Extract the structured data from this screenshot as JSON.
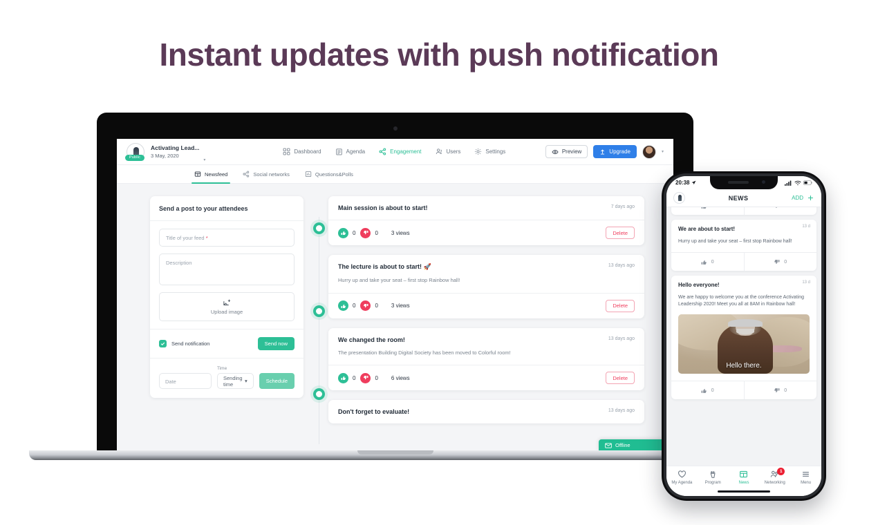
{
  "headline": "Instant updates with push notification",
  "laptop": {
    "appbar": {
      "event_name": "Activating Lead...",
      "event_date": "3 May, 2020",
      "visibility_badge": "Public",
      "caret": "▾",
      "nav": [
        {
          "label": "Dashboard",
          "icon": "grid-icon",
          "active": false
        },
        {
          "label": "Agenda",
          "icon": "calendar-icon",
          "active": false
        },
        {
          "label": "Engagement",
          "icon": "share-icon",
          "active": true
        },
        {
          "label": "Users",
          "icon": "users-icon",
          "active": false
        },
        {
          "label": "Settings",
          "icon": "gear-icon",
          "active": false
        }
      ],
      "preview_label": "Preview",
      "upgrade_label": "Upgrade"
    },
    "tabs": [
      {
        "label": "Newsfeed",
        "icon": "newsfeed-icon",
        "active": true
      },
      {
        "label": "Social networks",
        "icon": "share-icon",
        "active": false
      },
      {
        "label": "Questions&Polls",
        "icon": "poll-icon",
        "active": false
      }
    ],
    "compose": {
      "heading": "Send a post to your attendees",
      "title_placeholder": "Title of your feed",
      "title_required_mark": "*",
      "title_value": "",
      "description_placeholder": "Description",
      "description_value": "",
      "upload_label": "Upload image",
      "notification_label": "Send notification",
      "notification_checked": true,
      "send_now_label": "Send now",
      "date_placeholder": "Date",
      "date_value": "",
      "time_label": "Time",
      "time_value": "Sending time",
      "time_caret": "▾",
      "schedule_label": "Schedule"
    },
    "posts": [
      {
        "title": "Main session is about to start!",
        "time": "7 days ago",
        "text": "",
        "likes": "0",
        "dislikes": "0",
        "views": "3 views",
        "delete_label": "Delete"
      },
      {
        "title": "The lecture is about to start! 🚀",
        "time": "13 days ago",
        "text": "Hurry up and take your seat – first stop Rainbow hall!",
        "likes": "0",
        "dislikes": "0",
        "views": "3 views",
        "delete_label": "Delete"
      },
      {
        "title": "We changed the room!",
        "time": "13 days ago",
        "text": "The presentation Building Digital Society has been moved to Colorful room!",
        "likes": "0",
        "dislikes": "0",
        "views": "6 views",
        "delete_label": "Delete"
      },
      {
        "title": "Don't forget to evaluate!",
        "time": "13 days ago",
        "text": "",
        "likes": "",
        "dislikes": "",
        "views": "",
        "delete_label": ""
      }
    ],
    "chat_widget": {
      "label": "Offline",
      "icon": "envelope-icon"
    }
  },
  "phone": {
    "statusbar": {
      "time": "20:38",
      "location_icon": "location-arrow-icon",
      "signal_icon": "signal-icon",
      "wifi_icon": "wifi-icon",
      "battery_icon": "battery-icon"
    },
    "header": {
      "title": "NEWS",
      "add_label": "ADD",
      "add_icon": "plus-icon",
      "logo_icon": "event-logo-icon"
    },
    "cards": [
      {
        "title": "We are about to start!",
        "day": "13 d",
        "text": "Hurry up and take your seat – first stop Rainbow hall!",
        "likes": "0",
        "dislikes": "0",
        "has_image": false,
        "image_caption": ""
      },
      {
        "title": "Hello everyone!",
        "day": "13 d",
        "text": "We are happy to welcome you at the conference Activating Leadership 2020! Meet you all at 8AM in Rainbow hall!",
        "likes": "0",
        "dislikes": "0",
        "has_image": true,
        "image_caption": "Hello there."
      }
    ],
    "tabbar": [
      {
        "label": "My Agenda",
        "icon": "heart-icon",
        "active": false,
        "badge": ""
      },
      {
        "label": "Program",
        "icon": "podium-icon",
        "active": false,
        "badge": ""
      },
      {
        "label": "News",
        "icon": "news-icon",
        "active": true,
        "badge": ""
      },
      {
        "label": "Networking",
        "icon": "networking-icon",
        "active": false,
        "badge": "1"
      },
      {
        "label": "Menu",
        "icon": "hamburger-icon",
        "active": false,
        "badge": ""
      }
    ]
  },
  "colors": {
    "headline": "#5b3a57",
    "teal": "#2dbf96",
    "blue": "#2f7fe8",
    "red": "#ef3d5d",
    "badge_red": "#ec1f32"
  }
}
